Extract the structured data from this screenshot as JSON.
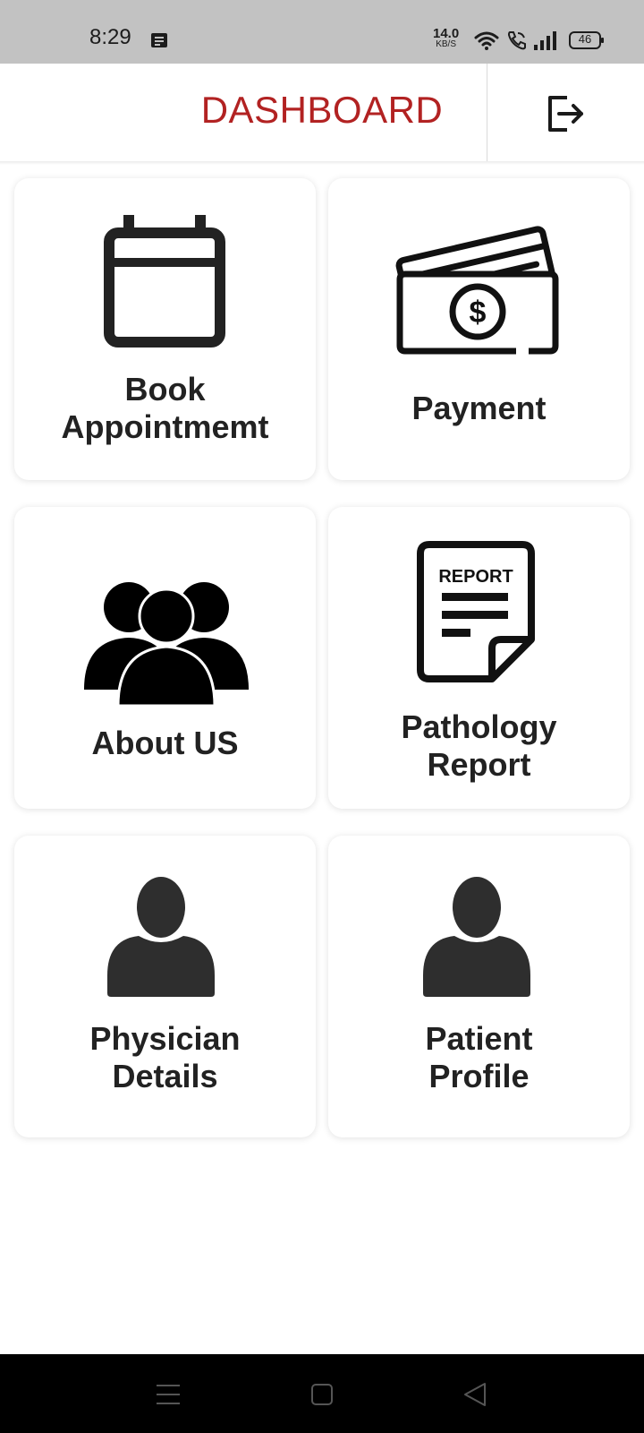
{
  "status_bar": {
    "time": "8:29",
    "net_speed_value": "14.0",
    "net_speed_unit": "KB/S",
    "battery": "46"
  },
  "header": {
    "title": "DASHBOARD",
    "title_color": "#b22222",
    "logout_icon": "logout-icon"
  },
  "cards": [
    {
      "line1": "Book",
      "line2": "Appointmemt",
      "icon": "calendar-icon"
    },
    {
      "line1": "Payment",
      "line2": "",
      "icon": "payment-cards-icon"
    },
    {
      "line1": "About US",
      "line2": "",
      "icon": "group-icon"
    },
    {
      "line1": "Pathology",
      "line2": "Report",
      "icon": "report-icon",
      "icon_text": "REPORT"
    },
    {
      "line1": "Physician",
      "line2": "Details",
      "icon": "user-icon"
    },
    {
      "line1": "Patient",
      "line2": "Profile",
      "icon": "user-icon"
    }
  ],
  "nav_bar": {
    "buttons": [
      "menu-icon",
      "home-icon",
      "back-icon"
    ]
  }
}
